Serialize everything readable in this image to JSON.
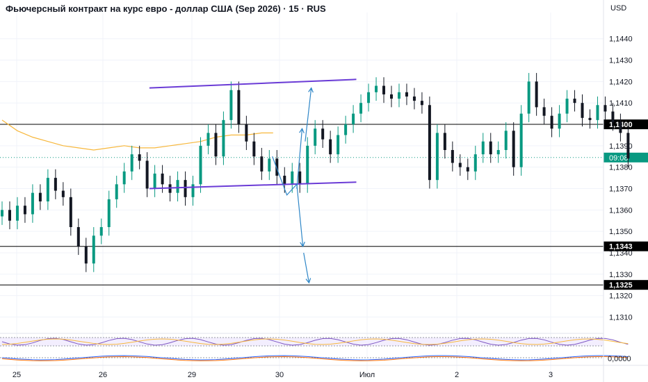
{
  "header": {
    "title": "Фьючерсный контракт на курс евро - доллар США (Sep 2026) · 15 · RUS",
    "currency": "USD"
  },
  "colors": {
    "up": "#089981",
    "down": "#131722",
    "channel": "#6a3bd6",
    "ma": "#f7b73b",
    "arrow": "#2e86c7",
    "grid": "#f0f3fa",
    "level": "#000000"
  },
  "chart_data": {
    "type": "candlestick",
    "title": "Фьючерсный контракт на курс евро - доллар США (Sep 2026) · 15 · RUS",
    "currency": "USD",
    "y_ticks": [
      "1,1440",
      "1,1430",
      "1,1420",
      "1,1410",
      "1,1390",
      "1,1380",
      "1,1370",
      "1,1360",
      "1,1350",
      "1,1340",
      "1,1330",
      "1,1320",
      "1,1310"
    ],
    "x_ticks": [
      "25",
      "26",
      "29",
      "30",
      "Июл",
      "2",
      "3"
    ],
    "ylim": [
      1.1303,
      1.1449
    ],
    "levels": [
      {
        "label": "1,1400",
        "value": 1.14
      },
      {
        "label": "1,1343",
        "value": 1.1343
      },
      {
        "label": "1,1325",
        "value": 1.1325
      }
    ],
    "current_price": {
      "value": 1.13845,
      "time_label": "09:08"
    },
    "channel": {
      "upper": [
        [
          19.3,
          1.1417
        ],
        [
          46.4,
          1.1421
        ]
      ],
      "lower": [
        [
          19.3,
          1.137
        ],
        [
          46.4,
          1.1373
        ]
      ]
    },
    "forecast_arrows": [
      [
        [
          35.4,
          1.1385
        ],
        [
          37.3,
          1.1367
        ],
        [
          38.6,
          1.1372
        ],
        [
          39.4,
          1.1343
        ]
      ],
      [
        [
          39.5,
          1.134
        ],
        [
          40.2,
          1.1326
        ]
      ],
      [
        [
          38.6,
          1.137
        ],
        [
          39.3,
          1.1398
        ]
      ],
      [
        [
          39.7,
          1.1392
        ],
        [
          40.5,
          1.1417
        ]
      ]
    ],
    "ma_path": [
      [
        0,
        1.1402
      ],
      [
        2,
        1.1397
      ],
      [
        4,
        1.1394
      ],
      [
        6,
        1.1392
      ],
      [
        8,
        1.139
      ],
      [
        10,
        1.1389
      ],
      [
        12,
        1.1388
      ],
      [
        14,
        1.1389
      ],
      [
        16,
        1.139
      ],
      [
        18,
        1.1389
      ],
      [
        20,
        1.1389
      ],
      [
        22,
        1.139
      ],
      [
        24,
        1.1391
      ],
      [
        26,
        1.1392
      ],
      [
        28,
        1.1394
      ],
      [
        30,
        1.1395
      ],
      [
        32,
        1.1395
      ],
      [
        34,
        1.1396
      ],
      [
        35.5,
        1.1396
      ]
    ],
    "series": [
      {
        "name": "price",
        "values": [
          1.136,
          1.1355,
          1.1362,
          1.1358,
          1.1368,
          1.1364,
          1.1375,
          1.1369,
          1.1366,
          1.1352,
          1.1343,
          1.1335,
          1.1348,
          1.1352,
          1.1365,
          1.1372,
          1.1378,
          1.1386,
          1.1383,
          1.137,
          1.1377,
          1.1372,
          1.1368,
          1.1374,
          1.1366,
          1.1372,
          1.139,
          1.1396,
          1.1385,
          1.1402,
          1.1416,
          1.14,
          1.1392,
          1.1385,
          1.1378,
          1.1384,
          1.1376,
          1.1372,
          1.1378,
          1.1372,
          1.139,
          1.1398,
          1.1393,
          1.1386,
          1.1395,
          1.14,
          1.1405,
          1.141,
          1.1415,
          1.1418,
          1.1414,
          1.1412,
          1.1415,
          1.1413,
          1.1411,
          1.1409,
          1.1374,
          1.1396,
          1.1388,
          1.1382,
          1.138,
          1.1378,
          1.1386,
          1.1392,
          1.1386,
          1.1388,
          1.1397,
          1.138,
          1.1405,
          1.142,
          1.1408,
          1.1404,
          1.1398,
          1.1405,
          1.1412,
          1.141,
          1.1403,
          1.1402,
          1.1409,
          1.1406,
          1.1401,
          1.1396,
          1.1384
        ]
      }
    ],
    "indicators": [
      {
        "name": "oscillator-1",
        "bands": [
          0.3,
          0.7
        ]
      },
      {
        "name": "oscillator-2",
        "zero_label": "0,0000"
      }
    ]
  }
}
